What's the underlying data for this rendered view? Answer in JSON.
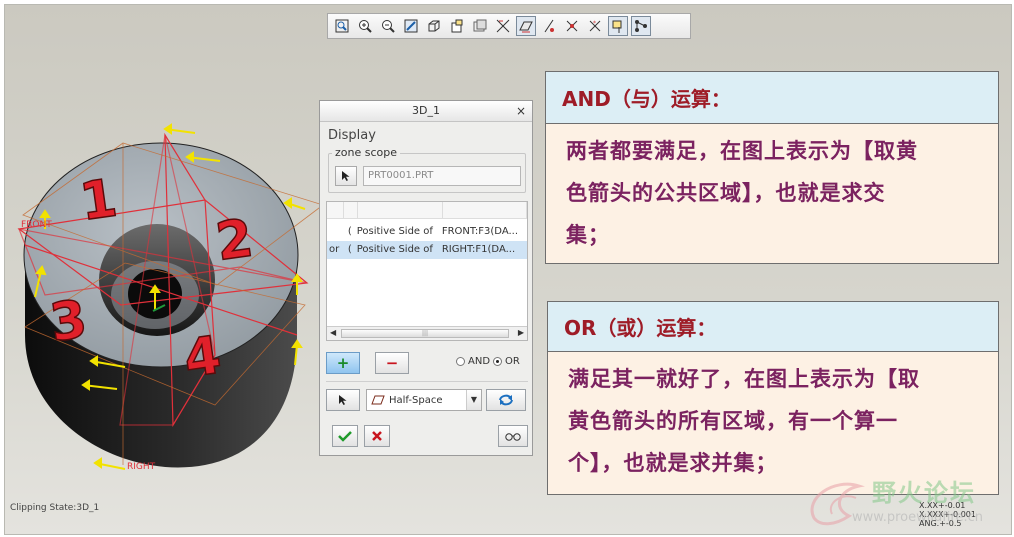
{
  "toolbar": {
    "icons": [
      "refit-icon",
      "zoom-in-icon",
      "zoom-out-icon",
      "repaint-icon",
      "display-style-icon",
      "saved-views-icon",
      "layers-icon",
      "datum-planes-icon",
      "datum-axes-icon",
      "datum-points-icon",
      "coordinate-system-icon",
      "annotations-icon",
      "spin-center-icon",
      "model-tree-icon"
    ]
  },
  "model": {
    "labels": [
      "1",
      "2",
      "3",
      "4"
    ],
    "front_label": "FRONT",
    "right_label": "RIGHT"
  },
  "dialog": {
    "title": "3D_1",
    "close": "×",
    "section": "Display",
    "group_label": "zone scope",
    "reference_placeholder": "PRT0001.PRT",
    "rows": [
      {
        "op": "",
        "paren": "(",
        "side": "Positive Side of",
        "ref": "FRONT:F3(DA..."
      },
      {
        "op": "or",
        "paren": "(",
        "side": "Positive Side of",
        "ref": "RIGHT:F1(DA..."
      }
    ],
    "add_label": "+",
    "remove_label": "−",
    "and_label": "AND",
    "or_label": "OR",
    "operator_selected": "OR",
    "combo_value": "Half-Space"
  },
  "status": {
    "clipping_state": "Clipping State:3D_1"
  },
  "panel_and": {
    "title": "AND（与）运算：",
    "lines": [
      "两者都要满足，在图上表示为【取黄",
      "色箭头的公共区域】，也就是求交",
      "集；"
    ]
  },
  "panel_or": {
    "title": "OR（或）运算：",
    "lines": [
      "满足其一就好了，在图上表示为【取",
      "黄色箭头的所有区域，有一个算一",
      "个】，也就是求并集；"
    ]
  },
  "tolerance": [
    "X.XX+-0.01",
    "X.XXX+-0.001",
    "ANG.+-0.5"
  ],
  "watermark": {
    "title": "野火论坛",
    "url": "www.proewildfire.cn"
  },
  "colors": {
    "accent_red": "#9e1c27",
    "body_purple": "#7b2260",
    "panel_fill": "#fdf1e4",
    "panel_head": "#dceef5",
    "arrow_yellow": "#f2e200",
    "datum_red": "#e0303a"
  }
}
